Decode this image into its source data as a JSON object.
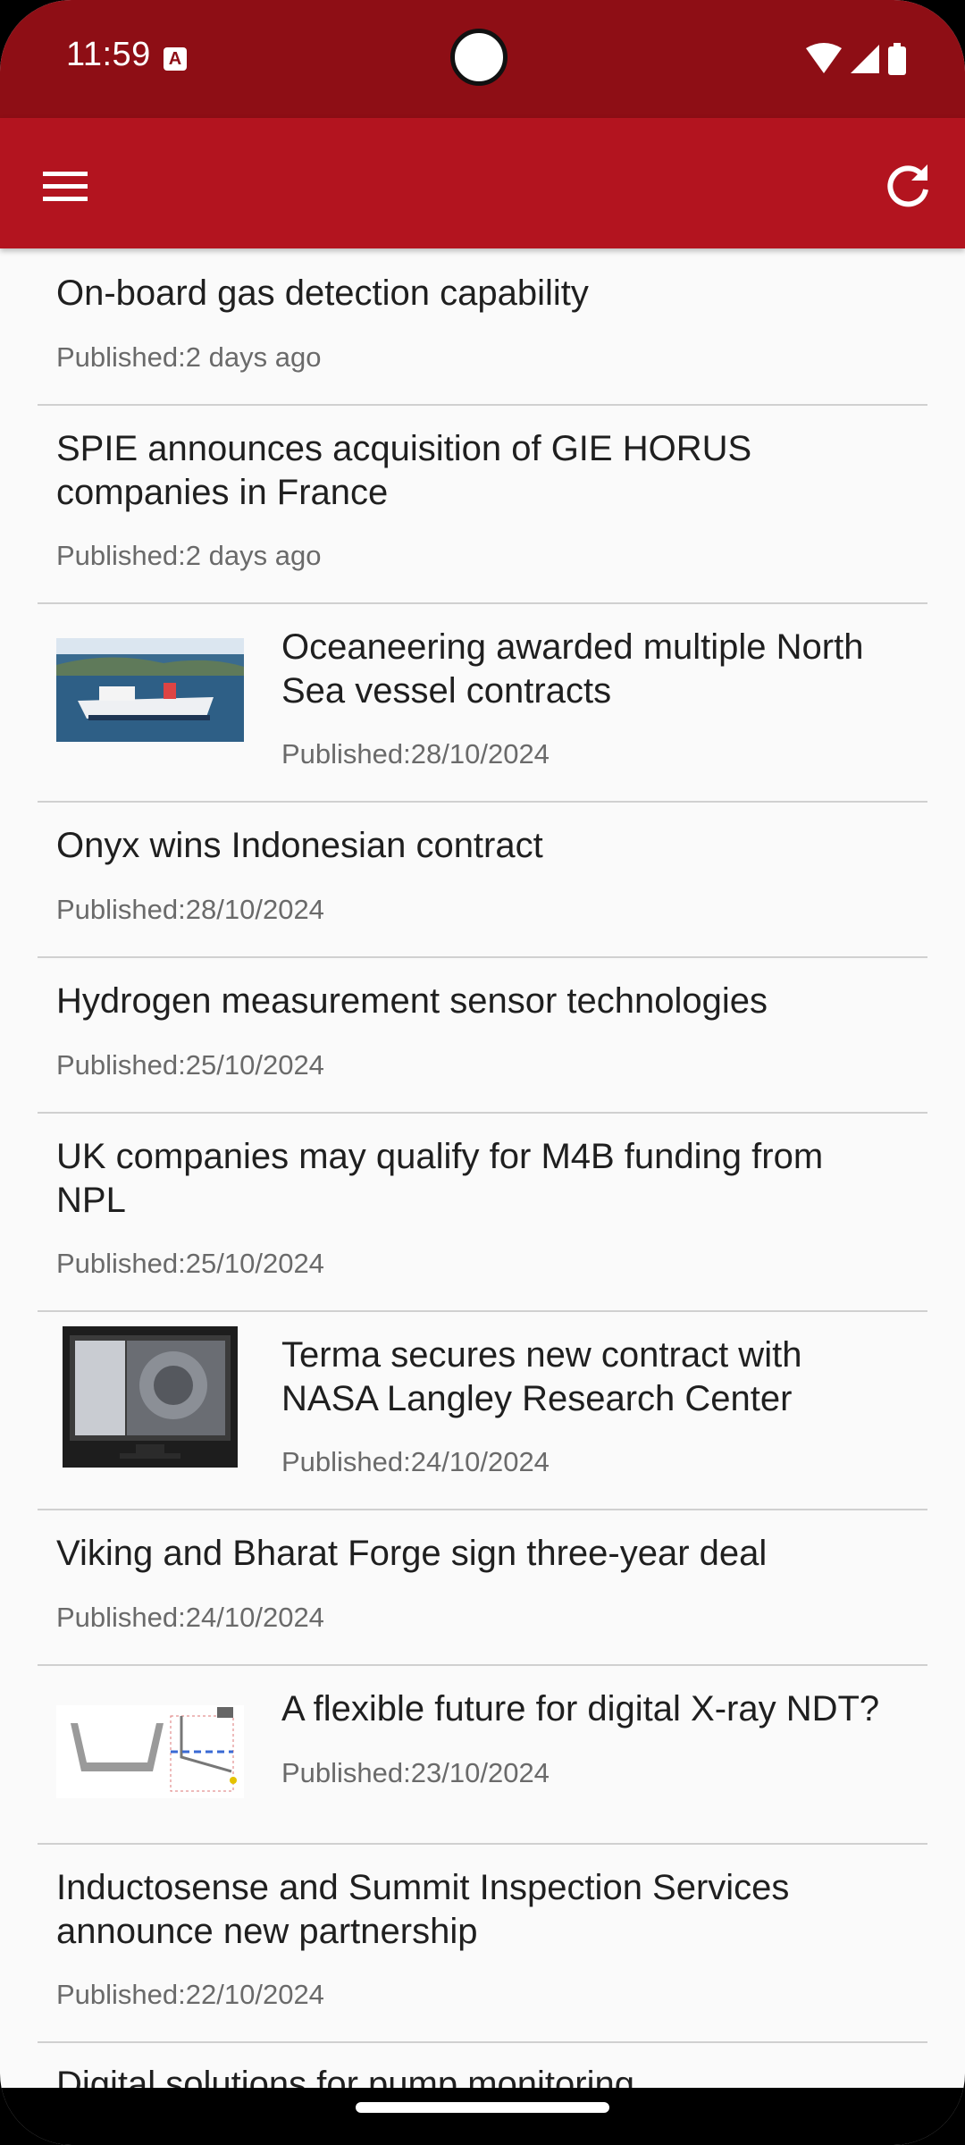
{
  "status_bar": {
    "time": "11:59",
    "notification_badge": "A",
    "icons": [
      "wifi-icon",
      "cell-signal-icon",
      "battery-icon"
    ]
  },
  "app_bar": {
    "menu_icon": "menu-icon",
    "refresh_icon": "refresh-icon",
    "color": "#b3141f",
    "status_color": "#8e0e15"
  },
  "articles": [
    {
      "title_lines": [
        "On-board gas detection capability"
      ],
      "published": "Published:2 days ago",
      "thumbnail": null
    },
    {
      "title_lines": [
        "SPIE announces acquisition of GIE HORUS",
        "companies in France"
      ],
      "published": "Published:2 days ago",
      "thumbnail": null
    },
    {
      "title_lines": [
        "Oceaneering awarded multiple North",
        "Sea vessel contracts"
      ],
      "published": "Published:28/10/2024",
      "thumbnail": "ship-image"
    },
    {
      "title_lines": [
        "Onyx wins Indonesian contract"
      ],
      "published": "Published:28/10/2024",
      "thumbnail": null
    },
    {
      "title_lines": [
        "Hydrogen measurement sensor technologies"
      ],
      "published": "Published:25/10/2024",
      "thumbnail": null
    },
    {
      "title_lines": [
        "UK companies may qualify for M4B funding from",
        "NPL"
      ],
      "published": "Published:25/10/2024",
      "thumbnail": null
    },
    {
      "title_lines": [
        "Terma secures new contract with",
        "NASA Langley Research Center"
      ],
      "published": "Published:24/10/2024",
      "thumbnail": "monitor-image"
    },
    {
      "title_lines": [
        "Viking and Bharat Forge sign three-year deal"
      ],
      "published": "Published:24/10/2024",
      "thumbnail": null
    },
    {
      "title_lines": [
        "A flexible future for digital X-ray NDT?"
      ],
      "published": "Published:23/10/2024",
      "thumbnail": "diagram-image"
    },
    {
      "title_lines": [
        "Inductosense and Summit Inspection Services",
        "announce new partnership"
      ],
      "published": "Published:22/10/2024",
      "thumbnail": null
    },
    {
      "title_lines": [
        "Digital solutions for pump monitoring"
      ],
      "published": "",
      "thumbnail": null
    }
  ]
}
